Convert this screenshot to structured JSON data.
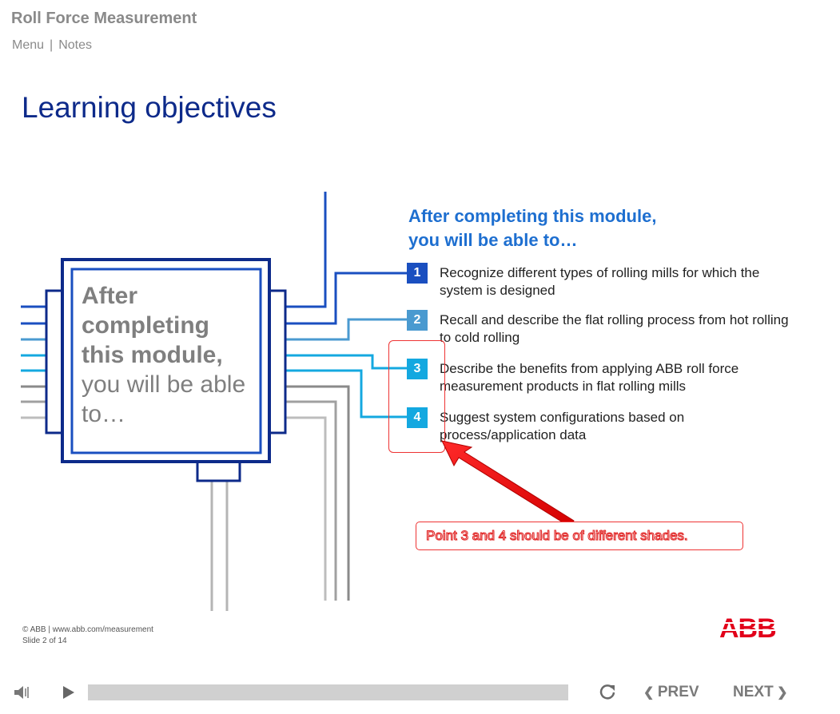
{
  "course": {
    "title": "Roll Force Measurement"
  },
  "nav": {
    "menu_label": "Menu",
    "separator": "|",
    "notes_label": "Notes"
  },
  "slide": {
    "title": "Learning objectives",
    "chip": {
      "bold_lines": [
        "After",
        "completing",
        "this module,"
      ],
      "normal_text": "you will be able to…"
    },
    "heading": [
      "After completing this module,",
      "you will be able to…"
    ],
    "objectives": [
      {
        "number": "1",
        "text": "Recognize different types of rolling mills for which the system is designed",
        "color": "#1a4fc0"
      },
      {
        "number": "2",
        "text": "Recall and describe the flat rolling process from hot rolling to cold rolling",
        "color": "#4a9ad0"
      },
      {
        "number": "3",
        "text": "Describe the benefits from applying ABB roll force measurement products in flat rolling mills",
        "color": "#14a8e0"
      },
      {
        "number": "4",
        "text": "Suggest system configurations based on process/application data",
        "color": "#14a8e0"
      }
    ],
    "annotation": "Point 3 and 4 should be of different shades."
  },
  "footer": {
    "copyright": "© ABB | www.abb.com/measurement",
    "slide_counter": "Slide 2 of 14",
    "logo_text": "ABB"
  },
  "player": {
    "prev_label": "PREV",
    "next_label": "NEXT",
    "volume_icon": "volume-icon",
    "play_icon": "play-icon",
    "replay_icon": "replay-icon"
  },
  "colors": {
    "title": "#0d2a8a",
    "heading": "#1e6fd0",
    "annotation": "#e01f1f",
    "abb_red": "#e2001a"
  }
}
